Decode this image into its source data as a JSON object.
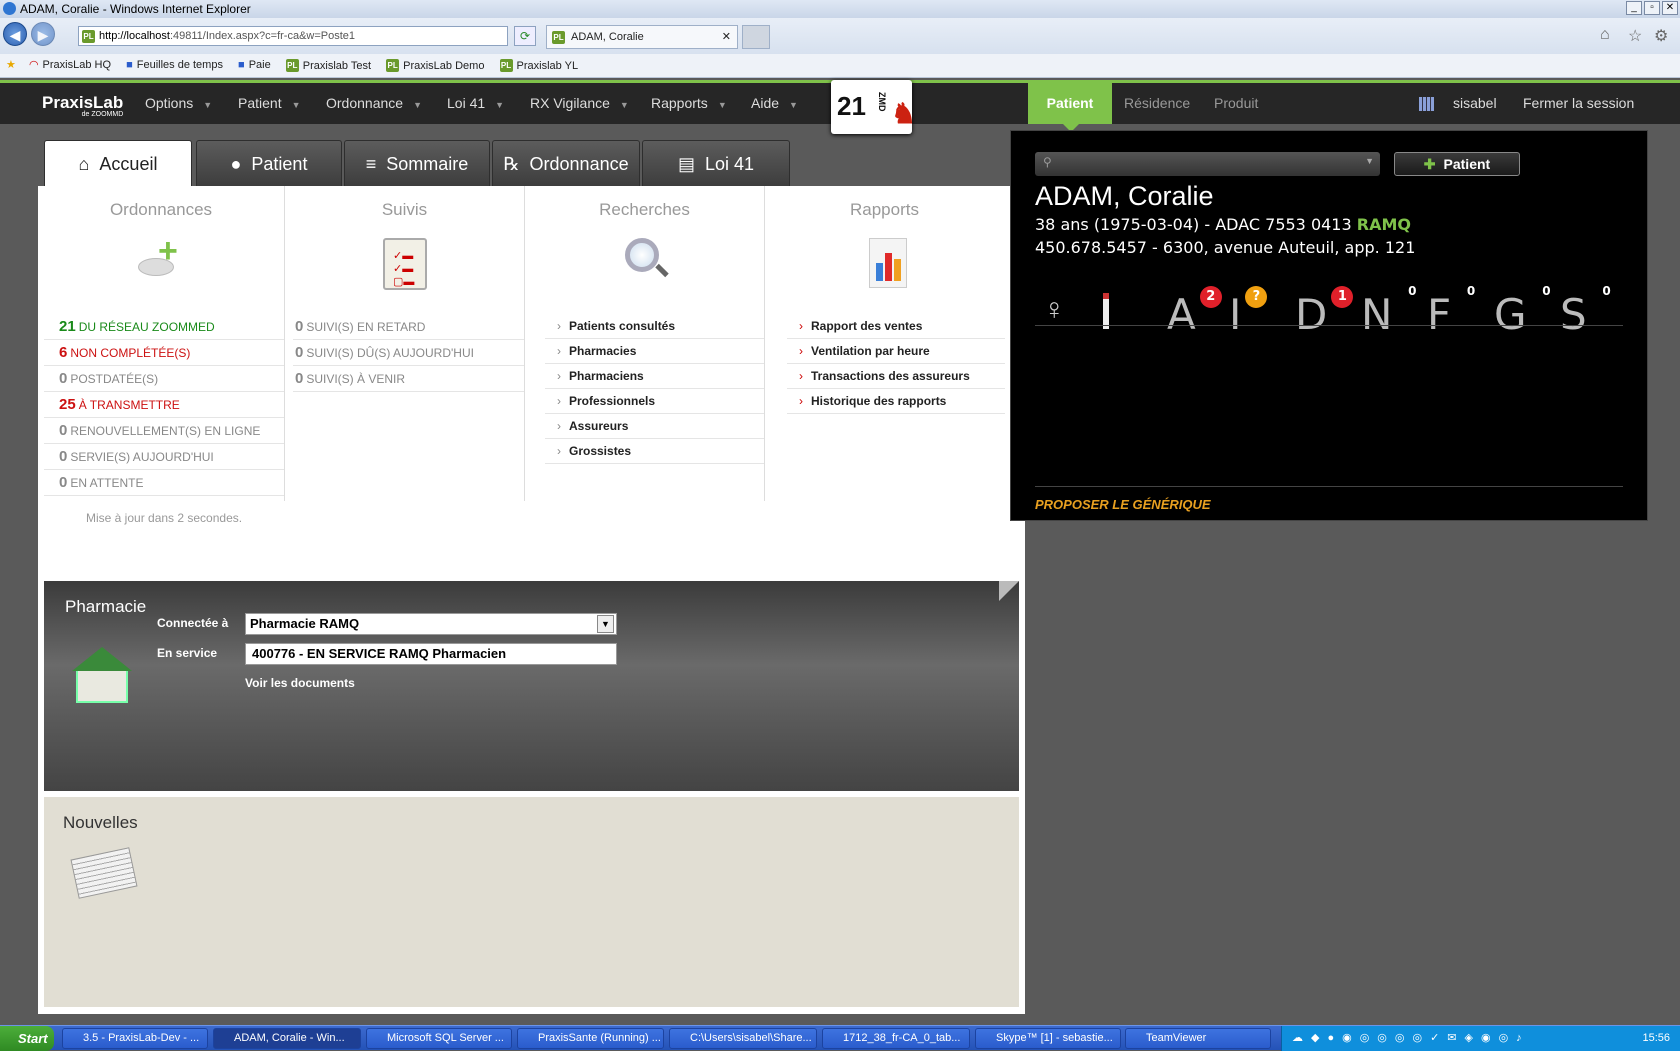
{
  "window": {
    "title": "ADAM, Coralie - Windows Internet Explorer",
    "min": "_",
    "max": "▫",
    "close": "✕"
  },
  "browser": {
    "url_host": "http://localhost",
    "url_rest": ":49811/Index.aspx?c=fr-ca&w=Poste1",
    "tab_label": "ADAM, Coralie",
    "tab_close": "✕"
  },
  "favorites": [
    "PraxisLab HQ",
    "Feuilles de temps",
    "Paie",
    "Praxislab Test",
    "PraxisLab Demo",
    "Praxislab YL"
  ],
  "app": {
    "logo": "PraxisLab",
    "logo_sub": "de ZOOMMD",
    "menu": [
      "Options",
      "Patient",
      "Ordonnance",
      "Loi 41",
      "RX Vigilance",
      "Rapports",
      "Aide"
    ],
    "badge_count": "21",
    "badge_tag": "ZMD",
    "right_tabs": [
      "Patient",
      "Résidence",
      "Produit"
    ],
    "user": "sisabel",
    "logout": "Fermer la session"
  },
  "tabs": [
    "Accueil",
    "Patient",
    "Sommaire",
    "Ordonnance",
    "Loi 41"
  ],
  "columns": {
    "ordonnances": {
      "title": "Ordonnances",
      "rows": [
        {
          "n": "21",
          "label": "du réseau ZoomMed",
          "color": "#1a8a1a"
        },
        {
          "n": "6",
          "label": "non complétée(s)",
          "color": "#cc1111"
        },
        {
          "n": "0",
          "label": "postdatée(s)",
          "color": "#888888"
        },
        {
          "n": "25",
          "label": "à transmettre",
          "color": "#cc1111"
        },
        {
          "n": "0",
          "label": "renouvellement(s) en ligne",
          "color": "#888888"
        },
        {
          "n": "0",
          "label": "servie(s) aujourd'hui",
          "color": "#888888"
        },
        {
          "n": "0",
          "label": "en attente",
          "color": "#888888"
        }
      ],
      "update": "Mise à jour dans 2 secondes."
    },
    "suivis": {
      "title": "Suivis",
      "rows": [
        {
          "n": "0",
          "label": "suivi(s) en retard"
        },
        {
          "n": "0",
          "label": "suivi(s) dû(s) aujourd'hui"
        },
        {
          "n": "0",
          "label": "suivi(s) à venir"
        }
      ]
    },
    "recherches": {
      "title": "Recherches",
      "links": [
        "Patients consultés",
        "Pharmacies",
        "Pharmaciens",
        "Professionnels",
        "Assureurs",
        "Grossistes"
      ]
    },
    "rapports": {
      "title": "Rapports",
      "links": [
        "Rapport des ventes",
        "Ventilation par heure",
        "Transactions des assureurs",
        "Historique des rapports"
      ]
    }
  },
  "pharmacie": {
    "title": "Pharmacie",
    "connected_label": "Connectée à",
    "connected_value": "Pharmacie RAMQ",
    "service_label": "En service",
    "service_value": "400776 - EN SERVICE RAMQ Pharmacien",
    "docs": "Voir les documents"
  },
  "nouvelles": {
    "title": "Nouvelles"
  },
  "patient": {
    "add_button": "Patient",
    "name": "ADAM, Coralie",
    "line1": "38 ans (1975-03-04) - ADAC 7553 0413 ",
    "insurer": "RAMQ",
    "line2": "450.678.5457 - 6300, avenue Auteuil, app. 121",
    "flags": [
      {
        "l": "A",
        "c": "2",
        "type": "red"
      },
      {
        "l": "I",
        "c": "?",
        "type": "orange"
      },
      {
        "l": "D",
        "c": "1",
        "type": "red"
      },
      {
        "l": "N",
        "c": "0",
        "type": "plain"
      },
      {
        "l": "F",
        "c": "0",
        "type": "plain"
      },
      {
        "l": "G",
        "c": "0",
        "type": "plain"
      },
      {
        "l": "S",
        "c": "0",
        "type": "plain"
      }
    ],
    "generic": "PROPOSER LE GÉNÉRIQUE"
  },
  "taskbar": {
    "start": "Start",
    "items": [
      "3.5 - PraxisLab-Dev - ...",
      "ADAM, Coralie - Win...",
      "Microsoft SQL Server ...",
      "PraxisSante (Running) ...",
      "C:\\Users\\sisabel\\Share...",
      "1712_38_fr-CA_0_tab...",
      "Skype™ [1] - sebastie...",
      "TeamViewer"
    ],
    "clock": "15:56"
  }
}
